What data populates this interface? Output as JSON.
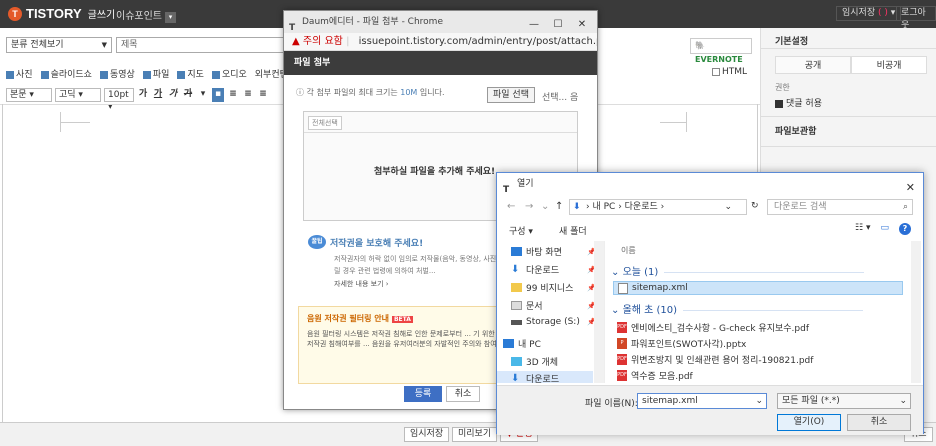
{
  "topbar": {
    "logo": "TISTORY",
    "logo_sub": "글쓰기",
    "blog": "이슈포인트",
    "temp_save": "임시저장",
    "temp_count": "(  )",
    "logout": "로그아웃"
  },
  "editor": {
    "category": "분류 전체보기",
    "title_placeholder": "제목",
    "evernote": "EVERNOTE",
    "media": [
      "사진",
      "슬라이드쇼",
      "동영상",
      "파일",
      "지도",
      "오디오",
      "외부컨텐츠"
    ],
    "html_label": "HTML",
    "format": {
      "style": "본문",
      "font": "고딕",
      "size": "10pt",
      "buttons": [
        "가",
        "가",
        "가",
        "가"
      ]
    }
  },
  "sidebar": {
    "basic_title": "기본설정",
    "public": "공개",
    "private": "비공개",
    "auth": "권한",
    "allow_comments": "댓글 허용",
    "file_storage": "파일보관함"
  },
  "bottom": {
    "temp_save": "임시저장",
    "preview": "미리보기",
    "publish": "발행",
    "cancel": "취소"
  },
  "chrome": {
    "title": "Daum에디터 - 파일 첨부 - Chrome",
    "warning": "주의 요함",
    "url": "issuepoint.tistory.com/admin/entry/post/attach.p...",
    "header": "파일 첨부",
    "max_info_prefix": "각 첨부 파일의 최대 크기는",
    "max_size": "10M",
    "max_info_suffix": "입니다.",
    "select_file": "파일 선택",
    "select_status": "선택... 음",
    "select_all": "전체선택",
    "drop_text": "첨부하실 파일을 추가해 주세요!",
    "copyright_title": "저작권을 보호해 주세요!",
    "copyright_body": "저작권자의 허락 없이 임의로 저작물(음악, 동영상, 사진 등)을 인터넷 게시판에 올릴 경우 관련 법령에 의하여 처벌...",
    "copyright_more": "자세한 내용 보기 ›",
    "filter_title": "음원 저작권 필터링 안내",
    "filter_badge": "BETA",
    "filter_body": "음원 필터링 시스템은 저작권 침해로 인한 문제로부터 ... 기 위한 조치로 현재 모든 음원의 저작권 침해여부를 ... 음원을 유저여러분의 자발적인 주의와 참여가 필요합니다.",
    "register": "등록",
    "cancel": "취소"
  },
  "open_dialog": {
    "title": "열기",
    "path": [
      "내 PC",
      "다운로드"
    ],
    "search_placeholder": "다운로드 검색",
    "organize": "구성 ▾",
    "new_folder": "새 폴더",
    "nav": [
      {
        "label": "바탕 화면",
        "pinned": true
      },
      {
        "label": "다운로드",
        "pinned": true
      },
      {
        "label": "99 비지니스",
        "pinned": true
      },
      {
        "label": "문서",
        "pinned": true
      },
      {
        "label": "Storage (S:)",
        "pinned": true
      },
      {
        "label": "내 PC",
        "pinned": false
      },
      {
        "label": "3D 개체",
        "pinned": false
      },
      {
        "label": "다운로드",
        "pinned": false
      }
    ],
    "column": "이름",
    "group_today": "오늘 (1)",
    "today_files": [
      "sitemap.xml"
    ],
    "group_year": "올해 초 (10)",
    "year_files": [
      "엔비에스티_검수사항 - G-check 유지보수.pdf",
      "파워포인트(SWOT사각).pptx",
      "위변조방지 및 인쇄관련 용어 정리-190821.pdf",
      "역수증 모음.pdf"
    ],
    "filename_label": "파일 이름(N):",
    "filename": "sitemap.xml",
    "filetype": "모든 파일 (*.*)",
    "open": "열기(O)",
    "cancel": "취소"
  }
}
